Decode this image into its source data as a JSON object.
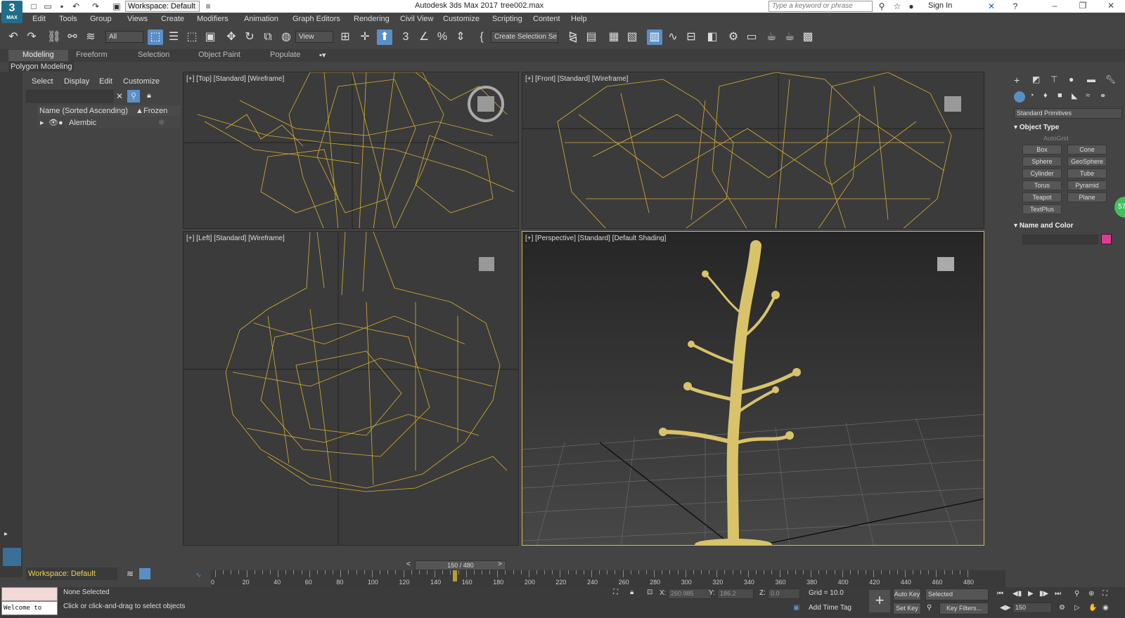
{
  "title_bar": {
    "workspace": "Workspace: Default",
    "app_name": "Autodesk 3ds Max 2017",
    "file_name": "tree002.max",
    "search_placeholder": "Type a keyword or phrase",
    "sign_in": "Sign In"
  },
  "logo": {
    "text": "3",
    "sub": "MAX"
  },
  "menu": [
    "Edit",
    "Tools",
    "Group",
    "Views",
    "Create",
    "Modifiers",
    "Animation",
    "Graph Editors",
    "Rendering",
    "Civil View",
    "Customize",
    "Scripting",
    "Content",
    "Help"
  ],
  "toolbar": {
    "filter": "All",
    "ref_coord": "View",
    "selection_set": "Create Selection Se"
  },
  "ribbon": {
    "tabs": [
      "Modeling",
      "Freeform",
      "Selection",
      "Object Paint",
      "Populate"
    ],
    "active_tab": "Modeling",
    "sub_label": "Polygon Modeling"
  },
  "explorer": {
    "menu": [
      "Select",
      "Display",
      "Edit",
      "Customize"
    ],
    "col_name": "Name (Sorted Ascending)",
    "col_frozen": "Frozen",
    "rows": [
      {
        "name": "Alembic"
      }
    ]
  },
  "viewports": {
    "top": "[+] [Top] [Standard] [Wireframe]",
    "front": "[+] [Front] [Standard] [Wireframe]",
    "left": "[+] [Left] [Standard] [Wireframe]",
    "perspective": "[+] [Perspective] [Standard] [Default Shading]"
  },
  "command_panel": {
    "category": "Standard Primitives",
    "object_type_title": "Object Type",
    "autogrid": "AutoGrid",
    "buttons": [
      "Box",
      "Cone",
      "Sphere",
      "GeoSphere",
      "Cylinder",
      "Tube",
      "Torus",
      "Pyramid",
      "Teapot",
      "Plane",
      "TextPlus"
    ],
    "name_color_title": "Name and Color",
    "swatch_color": "#e03a96"
  },
  "timeline": {
    "slider": "150 / 480",
    "ticks": [
      "0",
      "20",
      "40",
      "60",
      "80",
      "100",
      "120",
      "140",
      "160",
      "180",
      "200",
      "220",
      "240",
      "260",
      "280",
      "300",
      "320",
      "340",
      "360",
      "380",
      "400",
      "420",
      "440",
      "460",
      "480"
    ]
  },
  "status": {
    "workspace": "Workspace: Default",
    "script_text": "Welcome to MAX!",
    "none_selected": "None Selected",
    "prompt": "Click or click-and-drag to select objects",
    "x_label": "X:",
    "x_value": "260.985",
    "y_label": "Y:",
    "y_value": "186.2",
    "z_label": "Z:",
    "z_value": "0.0",
    "grid": "Grid = 10.0",
    "auto_key": "Auto Key",
    "selected": "Selected",
    "set_key": "Set Key",
    "key_filters": "Key Filters...",
    "add_time_tag": "Add Time Tag",
    "frame": "150",
    "badge": "57"
  },
  "colors": {
    "wireframe": "#d8b030",
    "accent": "#5a8fc6",
    "tree": "#d8c36a"
  }
}
